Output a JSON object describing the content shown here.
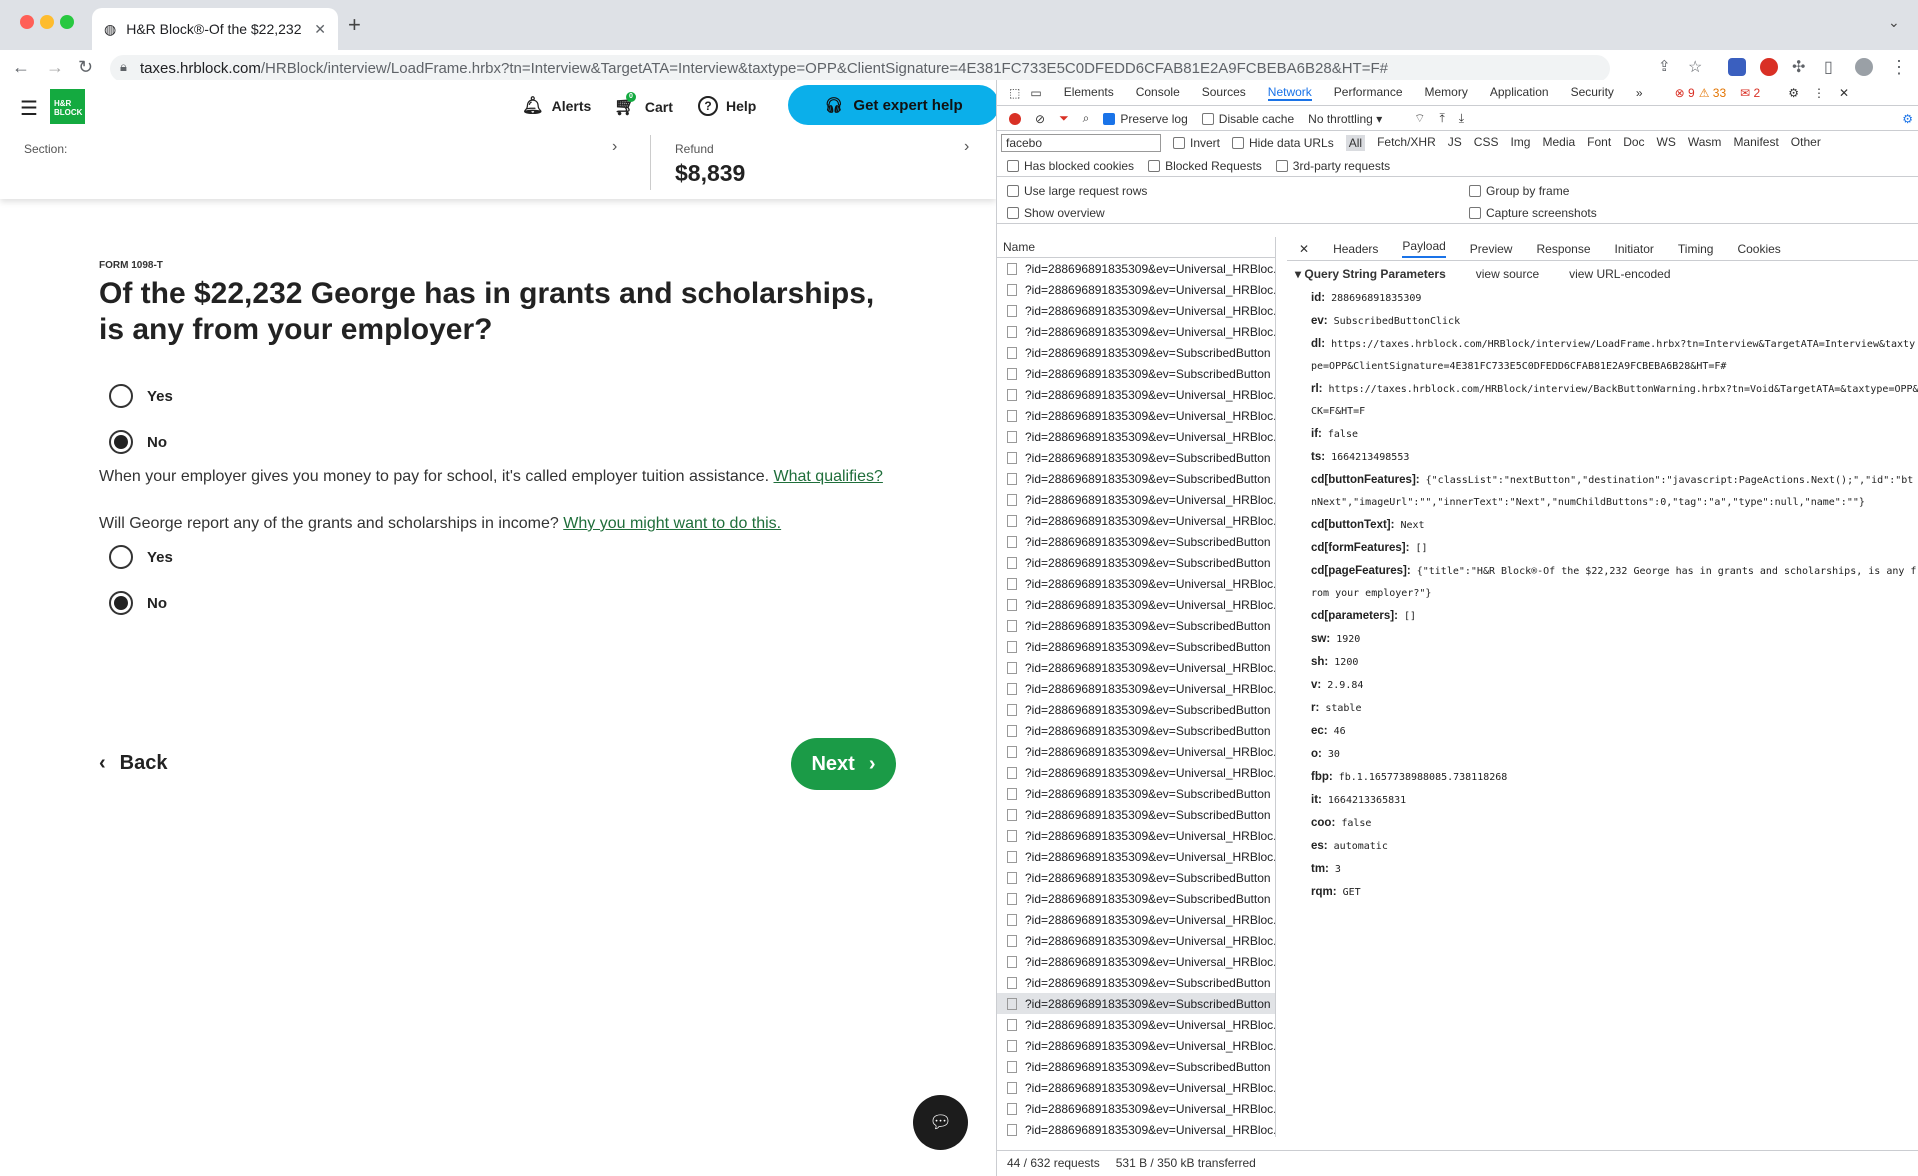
{
  "browser": {
    "tab_title": "H&R Block®-Of the $22,232 G",
    "url_host": "taxes.hrblock.com",
    "url_path": "/HRBlock/interview/LoadFrame.hrbx?tn=Interview&TargetATA=Interview&taxtype=OPP&ClientSignature=4E381FC733E5C0DFEDD6CFAB81E2A9FCBEBA6B28&HT=F#"
  },
  "header": {
    "logo_text": "H&R BLOCK",
    "alerts": "Alerts",
    "cart": "Cart",
    "cart_count": "0",
    "help": "Help",
    "expert_button": "Get expert help",
    "section_label": "Section:",
    "refund_label": "Refund",
    "refund_value": "$8,839"
  },
  "form": {
    "eyebrow": "FORM 1098-T",
    "title": "Of the $22,232 George has in grants and scholarships, is any from your employer?",
    "q1_yes": "Yes",
    "q1_no": "No",
    "q1_selected": "No",
    "help_text": "When your employer gives you money to pay for school, it's called employer tuition assistance.",
    "help_link": "What qualifies?",
    "question2": "Will George report any of the grants and scholarships in income?",
    "question2_link": "Why you might want to do this.",
    "q2_yes": "Yes",
    "q2_no": "No",
    "q2_selected": "No",
    "back": "Back",
    "next": "Next"
  },
  "devtools": {
    "tabs": [
      "Elements",
      "Console",
      "Sources",
      "Network",
      "Performance",
      "Memory",
      "Application",
      "Security"
    ],
    "active_tab": "Network",
    "badges": {
      "errors": "9",
      "warnings": "33",
      "issues": "2"
    },
    "preserve_log": "Preserve log",
    "disable_cache": "Disable cache",
    "throttling": "No throttling",
    "filter_value": "facebo",
    "invert": "Invert",
    "hide_data_urls": "Hide data URLs",
    "type_filters": [
      "All",
      "Fetch/XHR",
      "JS",
      "CSS",
      "Img",
      "Media",
      "Font",
      "Doc",
      "WS",
      "Wasm",
      "Manifest",
      "Other"
    ],
    "has_blocked_cookies": "Has blocked cookies",
    "blocked_requests": "Blocked Requests",
    "third_party": "3rd-party requests",
    "large_rows": "Use large request rows",
    "group_by_frame": "Group by frame",
    "show_overview": "Show overview",
    "capture_screenshots": "Capture screenshots",
    "name_header": "Name",
    "requests": [
      "?id=288696891835309&ev=Universal_HRBloc.",
      "?id=288696891835309&ev=Universal_HRBloc.",
      "?id=288696891835309&ev=Universal_HRBloc.",
      "?id=288696891835309&ev=Universal_HRBloc.",
      "?id=288696891835309&ev=SubscribedButton",
      "?id=288696891835309&ev=SubscribedButton",
      "?id=288696891835309&ev=Universal_HRBloc.",
      "?id=288696891835309&ev=Universal_HRBloc.",
      "?id=288696891835309&ev=Universal_HRBloc.",
      "?id=288696891835309&ev=SubscribedButton",
      "?id=288696891835309&ev=SubscribedButton",
      "?id=288696891835309&ev=Universal_HRBloc.",
      "?id=288696891835309&ev=Universal_HRBloc.",
      "?id=288696891835309&ev=SubscribedButton",
      "?id=288696891835309&ev=SubscribedButton",
      "?id=288696891835309&ev=Universal_HRBloc.",
      "?id=288696891835309&ev=Universal_HRBloc.",
      "?id=288696891835309&ev=SubscribedButton",
      "?id=288696891835309&ev=SubscribedButton",
      "?id=288696891835309&ev=Universal_HRBloc.",
      "?id=288696891835309&ev=Universal_HRBloc.",
      "?id=288696891835309&ev=SubscribedButton",
      "?id=288696891835309&ev=SubscribedButton",
      "?id=288696891835309&ev=Universal_HRBloc.",
      "?id=288696891835309&ev=Universal_HRBloc.",
      "?id=288696891835309&ev=SubscribedButton",
      "?id=288696891835309&ev=SubscribedButton",
      "?id=288696891835309&ev=Universal_HRBloc.",
      "?id=288696891835309&ev=Universal_HRBloc.",
      "?id=288696891835309&ev=SubscribedButton",
      "?id=288696891835309&ev=SubscribedButton",
      "?id=288696891835309&ev=Universal_HRBloc.",
      "?id=288696891835309&ev=Universal_HRBloc.",
      "?id=288696891835309&ev=Universal_HRBloc.",
      "?id=288696891835309&ev=SubscribedButton",
      "?id=288696891835309&ev=SubscribedButton",
      "?id=288696891835309&ev=Universal_HRBloc.",
      "?id=288696891835309&ev=Universal_HRBloc.",
      "?id=288696891835309&ev=SubscribedButton",
      "?id=288696891835309&ev=Universal_HRBloc.",
      "?id=288696891835309&ev=Universal_HRBloc.",
      "?id=288696891835309&ev=Universal_HRBloc."
    ],
    "selected_request_index": 35,
    "status": "44 / 632 requests",
    "transferred": "531 B / 350 kB transferred",
    "detail_tabs": [
      "Headers",
      "Payload",
      "Preview",
      "Response",
      "Initiator",
      "Timing",
      "Cookies"
    ],
    "detail_active": "Payload",
    "section_title": "Query String Parameters",
    "view_source": "view source",
    "view_url_encoded": "view URL-encoded",
    "params": [
      {
        "k": "id:",
        "v": "288696891835309"
      },
      {
        "k": "ev:",
        "v": "SubscribedButtonClick"
      },
      {
        "k": "dl:",
        "v": "https://taxes.hrblock.com/HRBlock/interview/LoadFrame.hrbx?tn=Interview&TargetATA=Interview&taxtype=OPP&ClientSignature=4E381FC733E5C0DFEDD6CFAB81E2A9FCBEBA6B28&HT=F#"
      },
      {
        "k": "rl:",
        "v": "https://taxes.hrblock.com/HRBlock/interview/BackButtonWarning.hrbx?tn=Void&TargetATA=&taxtype=OPP&CK=F&HT=F"
      },
      {
        "k": "if:",
        "v": "false"
      },
      {
        "k": "ts:",
        "v": "1664213498553"
      },
      {
        "k": "cd[buttonFeatures]:",
        "v": "{\"classList\":\"nextButton\",\"destination\":\"javascript:PageActions.Next();\",\"id\":\"btnNext\",\"imageUrl\":\"\",\"innerText\":\"Next\",\"numChildButtons\":0,\"tag\":\"a\",\"type\":null,\"name\":\"\"}"
      },
      {
        "k": "cd[buttonText]:",
        "v": "Next"
      },
      {
        "k": "cd[formFeatures]:",
        "v": "[]"
      },
      {
        "k": "cd[pageFeatures]:",
        "v": "{\"title\":\"H&R Block®-Of the $22,232 George has in grants and scholarships, is any from your employer?\"}"
      },
      {
        "k": "cd[parameters]:",
        "v": "[]"
      },
      {
        "k": "sw:",
        "v": "1920"
      },
      {
        "k": "sh:",
        "v": "1200"
      },
      {
        "k": "v:",
        "v": "2.9.84"
      },
      {
        "k": "r:",
        "v": "stable"
      },
      {
        "k": "ec:",
        "v": "46"
      },
      {
        "k": "o:",
        "v": "30"
      },
      {
        "k": "fbp:",
        "v": "fb.1.1657738988085.738118268"
      },
      {
        "k": "it:",
        "v": "1664213365831"
      },
      {
        "k": "coo:",
        "v": "false"
      },
      {
        "k": "es:",
        "v": "automatic"
      },
      {
        "k": "tm:",
        "v": "3"
      },
      {
        "k": "rqm:",
        "v": "GET"
      }
    ]
  }
}
